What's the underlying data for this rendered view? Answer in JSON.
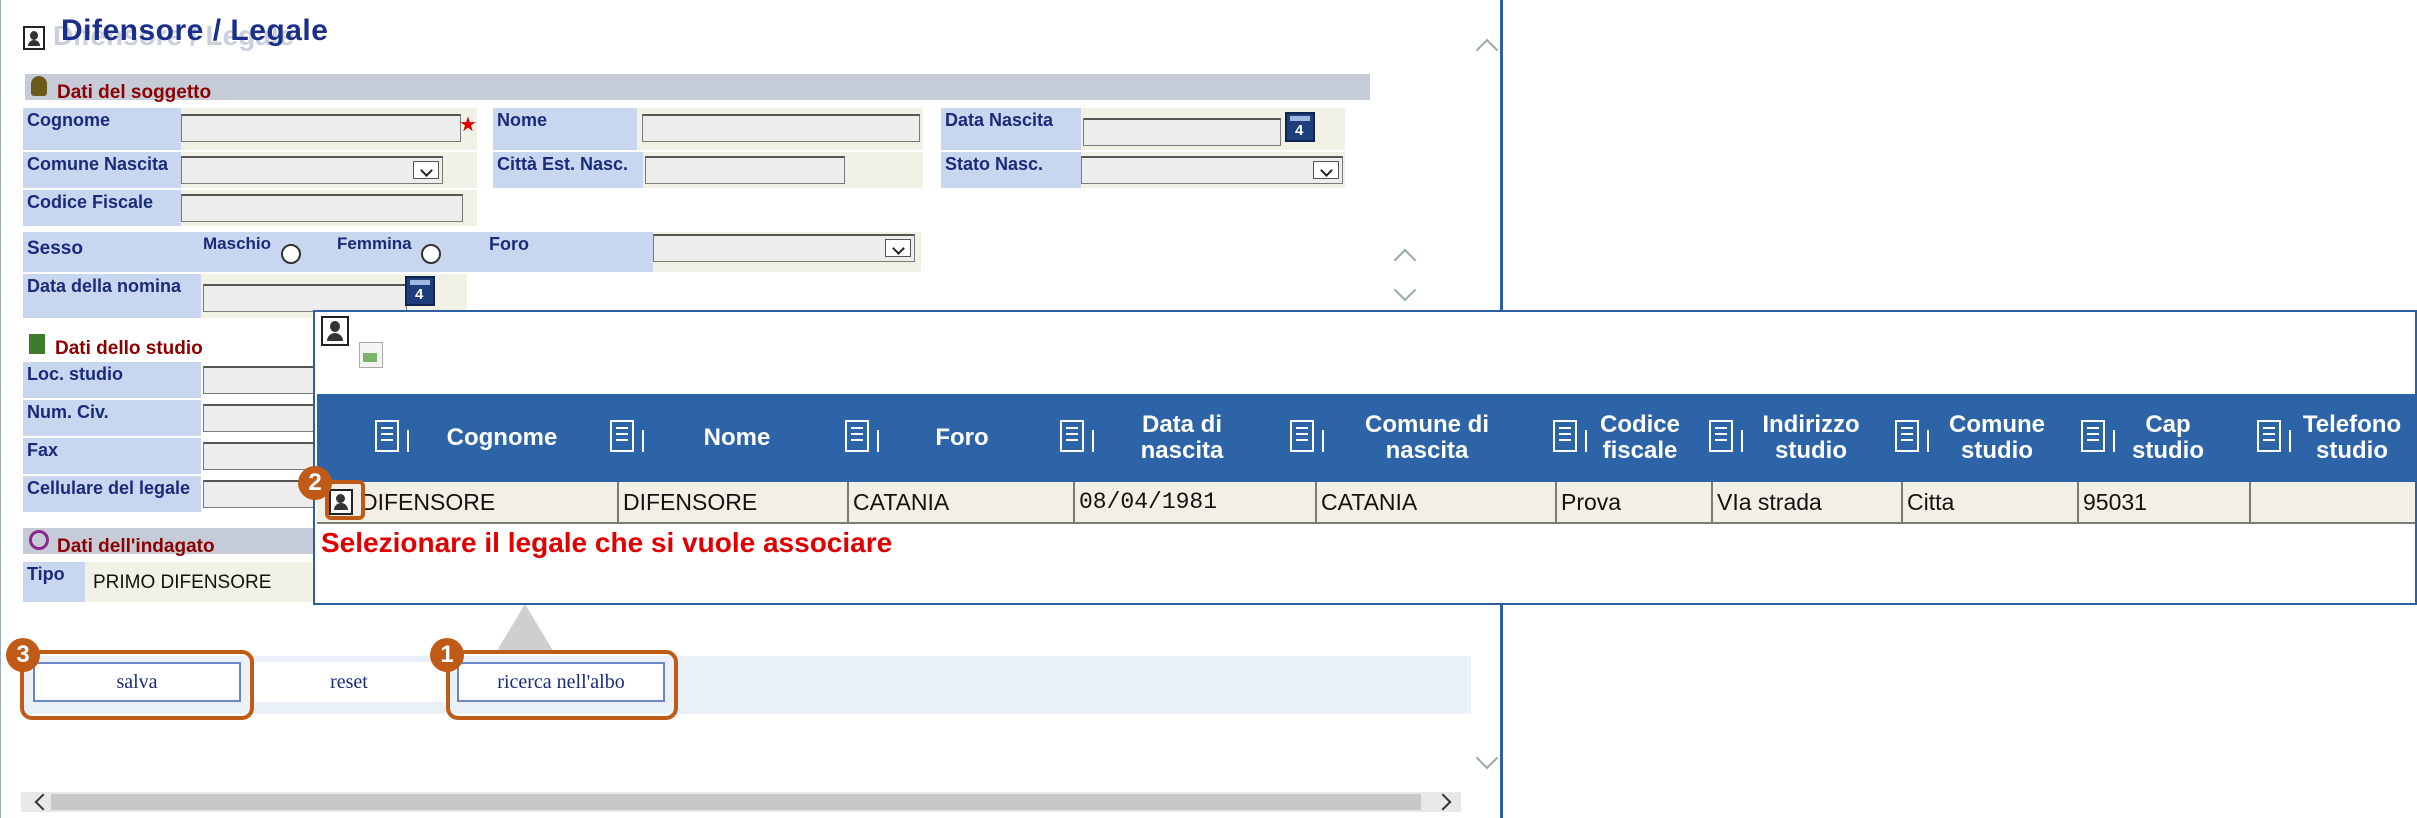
{
  "page": {
    "title": "Difensore / Legale",
    "title_shadow": "Difensore / Legale"
  },
  "soggetto": {
    "section_title": "Dati del soggetto",
    "cognome_label": "Cognome",
    "nome_label": "Nome",
    "data_nascita_label": "Data Nascita",
    "comune_nascita_label": "Comune Nascita",
    "citta_est_label": "Città Est. Nasc.",
    "stato_nasc_label": "Stato Nasc.",
    "codice_fiscale_label": "Codice Fiscale",
    "sesso_label": "Sesso",
    "maschio_label": "Maschio",
    "femmina_label": "Femmina",
    "foro_label": "Foro",
    "data_nomina_label": "Data della nomina"
  },
  "studio": {
    "section_title": "Dati dello studio",
    "loc_label": "Loc. studio",
    "num_civ_label": "Num. Civ.",
    "fax_label": "Fax",
    "cellulare_label": "Cellulare del legale"
  },
  "indagato": {
    "section_title": "Dati dell'indagato",
    "tipo_label": "Tipo",
    "tipo_value": "PRIMO DIFENSORE"
  },
  "popup": {
    "columns": [
      "Cognome",
      "Nome",
      "Foro",
      "Data di\nnascita",
      "Comune di\nnascita",
      "Codice\nfiscale",
      "Indirizzo\nstudio",
      "Comune\nstudio",
      "Cap\nstudio",
      "Telefono\nstudio"
    ],
    "row": [
      "DIFENSORE",
      "DIFENSORE",
      "CATANIA",
      "08/04/1981",
      "CATANIA",
      "Prova",
      "VIa strada",
      "Citta",
      "95031",
      ""
    ],
    "hint": "Selezionare il legale che si vuole associare"
  },
  "buttons": {
    "salva": "salva",
    "reset": "reset",
    "ricerca": "ricerca nell'albo"
  },
  "badges": {
    "one": "1",
    "two": "2",
    "three": "3"
  },
  "colors": {
    "header_blue": "#2d64a8",
    "callout_orange": "#c05a17",
    "section_red": "#8b0000",
    "hint_red": "#e00000"
  }
}
